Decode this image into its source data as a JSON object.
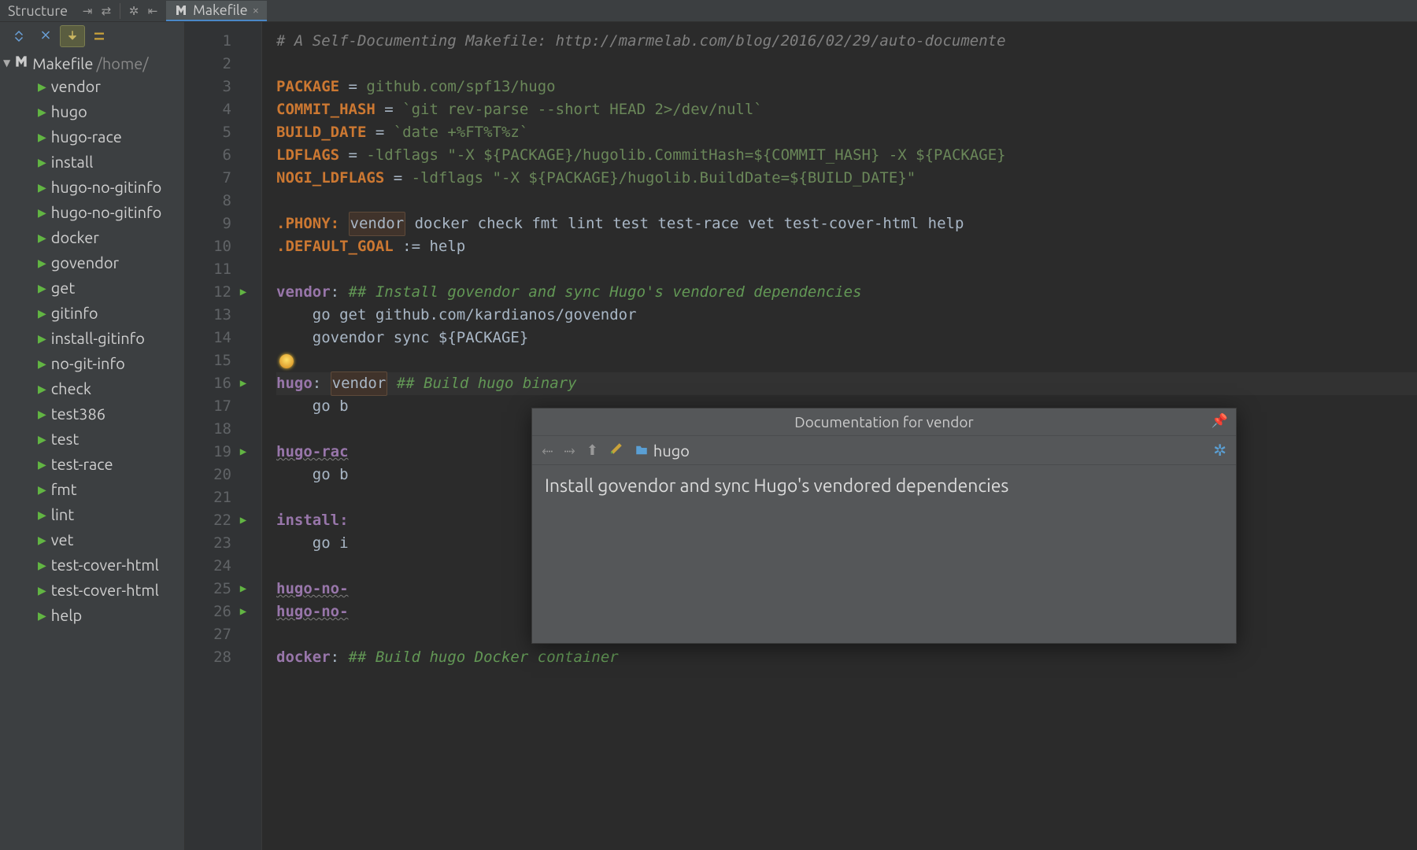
{
  "toolbar": {
    "structure_label": "Structure"
  },
  "tab": {
    "label": "Makefile"
  },
  "tree": {
    "root_name": "Makefile",
    "root_path": "/home/",
    "items": [
      "vendor",
      "hugo",
      "hugo-race",
      "install",
      "hugo-no-gitinfo",
      "hugo-no-gitinfo",
      "docker",
      "govendor",
      "get",
      "gitinfo",
      "install-gitinfo",
      "no-git-info",
      "check",
      "test386",
      "test",
      "test-race",
      "fmt",
      "lint",
      "vet",
      "test-cover-html",
      "test-cover-html",
      "help"
    ]
  },
  "code": {
    "lines": [
      {
        "n": 1,
        "segments": [
          {
            "t": "# A Self-Documenting Makefile: http://marmelab.com/blog/2016/02/29/auto-documente",
            "cls": "c-comment"
          }
        ]
      },
      {
        "n": 2,
        "segments": []
      },
      {
        "n": 3,
        "segments": [
          {
            "t": "PACKAGE",
            "cls": "c-var"
          },
          {
            "t": " = ",
            "cls": "c-op"
          },
          {
            "t": "github.com/spf13/hugo",
            "cls": "c-val"
          }
        ]
      },
      {
        "n": 4,
        "segments": [
          {
            "t": "COMMIT_HASH",
            "cls": "c-var"
          },
          {
            "t": " = ",
            "cls": "c-op"
          },
          {
            "t": "`git rev-parse --short HEAD 2>/dev/null`",
            "cls": "c-val"
          }
        ]
      },
      {
        "n": 5,
        "segments": [
          {
            "t": "BUILD_DATE",
            "cls": "c-var"
          },
          {
            "t": " = ",
            "cls": "c-op"
          },
          {
            "t": "`date +%FT%T%z`",
            "cls": "c-val"
          }
        ]
      },
      {
        "n": 6,
        "segments": [
          {
            "t": "LDFLAGS",
            "cls": "c-var"
          },
          {
            "t": " = ",
            "cls": "c-op"
          },
          {
            "t": "-ldflags \"-X ${PACKAGE}/hugolib.CommitHash=${COMMIT_HASH} -X ${PACKAGE}",
            "cls": "c-val"
          }
        ]
      },
      {
        "n": 7,
        "segments": [
          {
            "t": "NOGI_LDFLAGS",
            "cls": "c-var"
          },
          {
            "t": " = ",
            "cls": "c-op"
          },
          {
            "t": "-ldflags \"-X ${PACKAGE}/hugolib.BuildDate=${BUILD_DATE}\"",
            "cls": "c-val"
          }
        ]
      },
      {
        "n": 8,
        "segments": []
      },
      {
        "n": 9,
        "segments": [
          {
            "t": ".PHONY:",
            "cls": "c-var"
          },
          {
            "t": " ",
            "cls": "c-op"
          },
          {
            "t": "vendor",
            "cls": "hl-word"
          },
          {
            "t": " docker check fmt lint test test-race vet test-cover-html help",
            "cls": "c-plain"
          }
        ]
      },
      {
        "n": 10,
        "segments": [
          {
            "t": ".DEFAULT_GOAL",
            "cls": "c-var"
          },
          {
            "t": " := ",
            "cls": "c-op"
          },
          {
            "t": "help",
            "cls": "c-plain"
          }
        ]
      },
      {
        "n": 11,
        "segments": []
      },
      {
        "n": 12,
        "arrow": true,
        "fold": "open",
        "segments": [
          {
            "t": "vendor",
            "cls": "c-target"
          },
          {
            "t": ": ",
            "cls": "c-op"
          },
          {
            "t": "## Install govendor and sync Hugo's vendored dependencies",
            "cls": "c-doccomment"
          }
        ]
      },
      {
        "n": 13,
        "fold": "mid",
        "segments": [
          {
            "t": "    go get github.com/kardianos/govendor",
            "cls": "c-body"
          }
        ]
      },
      {
        "n": 14,
        "fold": "mid",
        "segments": [
          {
            "t": "    govendor sync ${PACKAGE}",
            "cls": "c-body"
          }
        ]
      },
      {
        "n": 15,
        "bulb": true,
        "segments": []
      },
      {
        "n": 16,
        "arrow": true,
        "fold": "open",
        "active": true,
        "segments": [
          {
            "t": "hugo",
            "cls": "c-target"
          },
          {
            "t": ": ",
            "cls": "c-op"
          },
          {
            "t": "vendor",
            "cls": "hl-word"
          },
          {
            "t": " ",
            "cls": "c-op"
          },
          {
            "t": "## Build hugo binary",
            "cls": "c-doccomment"
          }
        ]
      },
      {
        "n": 17,
        "fold": "mid",
        "segments": [
          {
            "t": "    go b",
            "cls": "c-body"
          }
        ]
      },
      {
        "n": 18,
        "segments": []
      },
      {
        "n": 19,
        "arrow": true,
        "fold": "open",
        "segments": [
          {
            "t": "hugo-rac",
            "cls": "c-target line-underline"
          }
        ]
      },
      {
        "n": 20,
        "fold": "mid",
        "segments": [
          {
            "t": "    go b",
            "cls": "c-body"
          }
        ]
      },
      {
        "n": 21,
        "segments": []
      },
      {
        "n": 22,
        "arrow": true,
        "fold": "open",
        "segments": [
          {
            "t": "install:",
            "cls": "c-target"
          }
        ]
      },
      {
        "n": 23,
        "fold": "mid",
        "segments": [
          {
            "t": "    go i",
            "cls": "c-body"
          }
        ]
      },
      {
        "n": 24,
        "segments": []
      },
      {
        "n": 25,
        "arrow": true,
        "fold": "open",
        "segments": [
          {
            "t": "hugo-no-",
            "cls": "c-target line-underline"
          }
        ]
      },
      {
        "n": 26,
        "arrow": true,
        "fold": "open",
        "segments": [
          {
            "t": "hugo-no-",
            "cls": "c-target line-underline"
          }
        ]
      },
      {
        "n": 27,
        "segments": []
      },
      {
        "n": 28,
        "fold": "open",
        "segments": [
          {
            "t": "docker",
            "cls": "c-target"
          },
          {
            "t": ": ",
            "cls": "c-op"
          },
          {
            "t": "## Build hugo Docker container",
            "cls": "c-doccomment"
          }
        ]
      }
    ]
  },
  "doc_popup": {
    "title": "Documentation for vendor",
    "crumb": "hugo",
    "body": "Install govendor and sync Hugo's vendored dependencies"
  }
}
